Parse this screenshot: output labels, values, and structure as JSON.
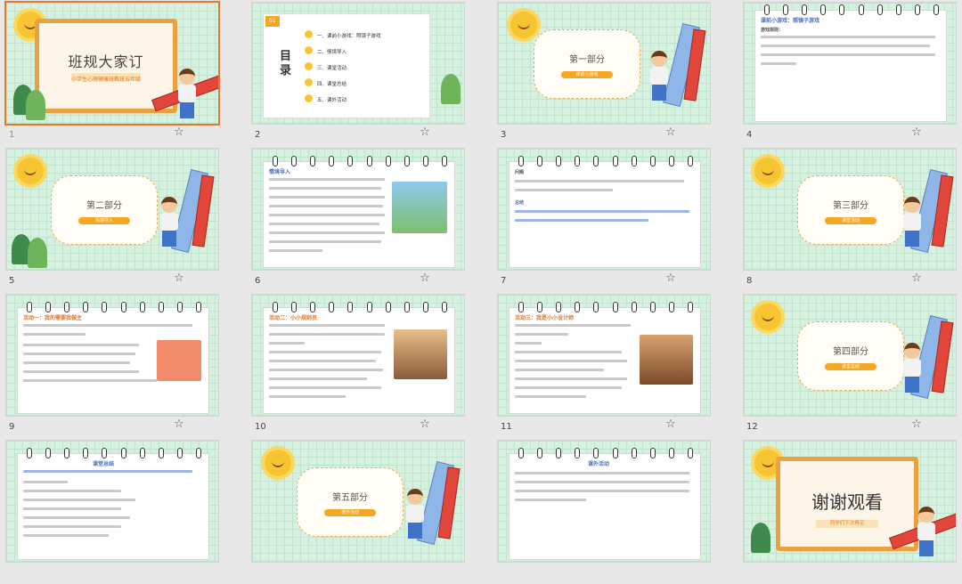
{
  "slides": [
    {
      "num": "1",
      "kind": "title",
      "title": "班规大家订",
      "subtitle": "小学生心理健康班教班五年级"
    },
    {
      "num": "2",
      "kind": "toc",
      "tag": "01",
      "heading": "目录",
      "items": [
        "一、课前小游戏：照镜子游戏",
        "二、情境导入",
        "三、课堂活动",
        "四、课堂总结",
        "五、课外活动"
      ]
    },
    {
      "num": "3",
      "kind": "section",
      "title": "第一部分",
      "pill": "课前小游戏"
    },
    {
      "num": "4",
      "kind": "page",
      "heading": "课前小游戏：照镜子游戏",
      "sub": "游戏规则："
    },
    {
      "num": "5",
      "kind": "section",
      "title": "第二部分",
      "pill": "情境导入"
    },
    {
      "num": "6",
      "kind": "page",
      "heading": "情境导入"
    },
    {
      "num": "7",
      "kind": "page",
      "heading": "问题",
      "sub": "总结"
    },
    {
      "num": "8",
      "kind": "section",
      "title": "第三部分",
      "pill": "课堂活动"
    },
    {
      "num": "9",
      "kind": "page",
      "heading": "活动一：我的需要我做主"
    },
    {
      "num": "10",
      "kind": "page",
      "heading": "活动二：小小规则员"
    },
    {
      "num": "11",
      "kind": "page",
      "heading": "活动三：我是小小设计师"
    },
    {
      "num": "12",
      "kind": "section",
      "title": "第四部分",
      "pill": "课堂总结"
    },
    {
      "num": "",
      "kind": "page",
      "heading": "课堂总结"
    },
    {
      "num": "",
      "kind": "section",
      "title": "第五部分",
      "pill": "课外活动"
    },
    {
      "num": "",
      "kind": "page",
      "heading": "课外活动"
    },
    {
      "num": "",
      "kind": "thanks",
      "title": "谢谢观看",
      "subtitle": "同学们下次再见"
    }
  ],
  "ui": {
    "star_icon": "star-outline-icon",
    "accent": "#e07b2d"
  }
}
